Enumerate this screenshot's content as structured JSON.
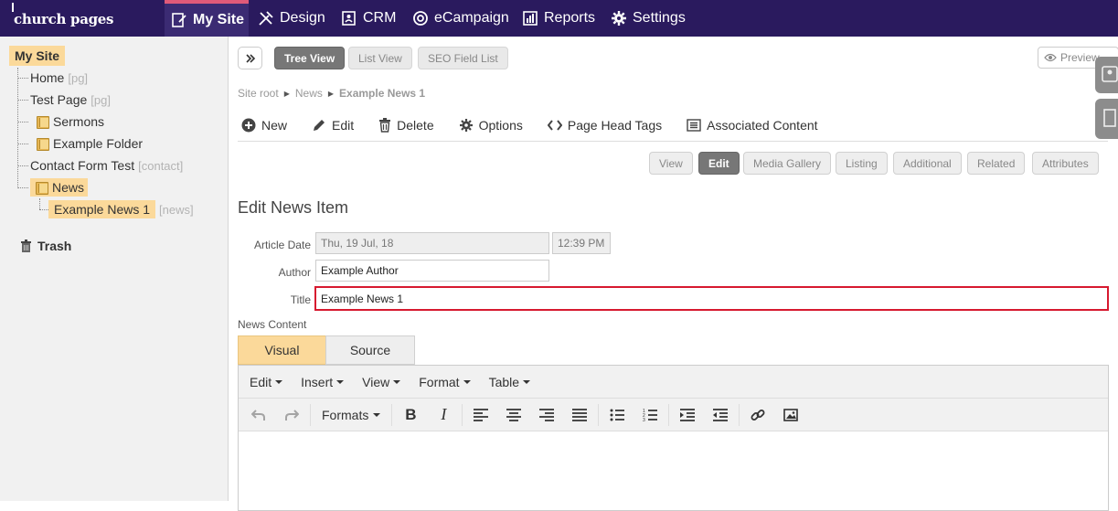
{
  "app": {
    "logo": "church pages"
  },
  "nav": {
    "items": [
      {
        "label": "My Site",
        "icon": "edit-page-icon"
      },
      {
        "label": "Design",
        "icon": "tools-icon"
      },
      {
        "label": "CRM",
        "icon": "contacts-icon"
      },
      {
        "label": "eCampaign",
        "icon": "at-icon"
      },
      {
        "label": "Reports",
        "icon": "bar-chart-icon"
      },
      {
        "label": "Settings",
        "icon": "gear-icon"
      }
    ],
    "active": "My Site"
  },
  "sidebar": {
    "root": "My Site",
    "nodes": [
      {
        "label": "Home",
        "tag": "[pg]"
      },
      {
        "label": "Test Page",
        "tag": "[pg]"
      },
      {
        "label": "Sermons",
        "tag": ""
      },
      {
        "label": "Example Folder",
        "tag": ""
      },
      {
        "label": "Contact Form Test",
        "tag": "[contact]"
      },
      {
        "label": "News",
        "tag": ""
      },
      {
        "label": "Example News 1",
        "tag": "[news]"
      }
    ],
    "trash": "Trash"
  },
  "view_tabs": {
    "tree": "Tree View",
    "list": "List View",
    "seo": "SEO Field List",
    "preview": "Preview"
  },
  "breadcrumb": {
    "root": "Site root",
    "parent": "News",
    "current": "Example News 1"
  },
  "toolbar": {
    "new": "New",
    "edit": "Edit",
    "delete": "Delete",
    "options": "Options",
    "head_tags": "Page Head Tags",
    "associated": "Associated Content"
  },
  "sub_tabs": {
    "view": "View",
    "edit": "Edit",
    "media": "Media Gallery",
    "listing": "Listing",
    "additional": "Additional",
    "related": "Related",
    "attributes": "Attributes"
  },
  "form": {
    "heading": "Edit News Item",
    "article_date_label": "Article Date",
    "article_date": "Thu, 19 Jul, 18",
    "article_time": "12:39 PM",
    "author_label": "Author",
    "author": "Example Author",
    "title_label": "Title",
    "title": "Example News 1",
    "content_label": "News Content"
  },
  "editor": {
    "tabs": {
      "visual": "Visual",
      "source": "Source"
    },
    "menus": {
      "edit": "Edit",
      "insert": "Insert",
      "view": "View",
      "format": "Format",
      "table": "Table"
    },
    "formats": "Formats"
  },
  "colors": {
    "nav_bg": "#2a1a5e",
    "accent_pink": "#e05a79",
    "highlight": "#fbd99a",
    "title_border": "#d7192f"
  }
}
